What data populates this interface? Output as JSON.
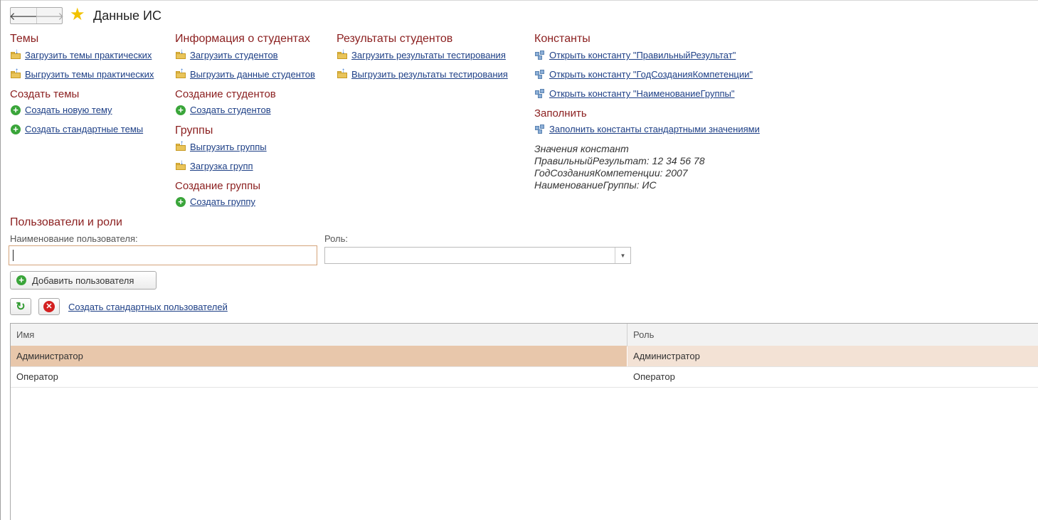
{
  "header": {
    "title": "Данные ИС",
    "back": "🡐",
    "forward": "🡒"
  },
  "themes": {
    "heading": "Темы",
    "load": "Загрузить темы практических",
    "unload": "Выгрузить темы практических",
    "create_heading": "Создать темы",
    "create_new": "Создать новую тему",
    "create_std": "Создать стандартные темы"
  },
  "students": {
    "heading": "Информация о студентах",
    "load": "Загрузить студентов",
    "unload": "Выгрузить данные студентов",
    "create_heading": "Создание студентов",
    "create": "Создать студентов"
  },
  "groups": {
    "heading": "Группы",
    "unload": "Выгрузить группы",
    "load": "Загрузка групп",
    "create_heading": "Создание группы",
    "create": "Создать группу"
  },
  "results": {
    "heading": "Результаты студентов",
    "load": "Загрузить результаты тестирования",
    "unload": "Выгрузить результаты тестирования"
  },
  "constants": {
    "heading": "Константы",
    "open1": "Открыть константу \"ПравильныйРезультат\"",
    "open2": "Открыть константу \"ГодСозданияКомпетенции\"",
    "open3": "Открыть константу \"НаименованиеГруппы\"",
    "fill_heading": "Заполнить",
    "fill": "Заполнить константы стандартными значениями",
    "values_title": "Значения констант",
    "value1": "ПравильныйРезультат: 12 34 56 78",
    "value2": "ГодСозданияКомпетенции: 2007",
    "value3": "НаименованиеГруппы: ИС"
  },
  "users": {
    "heading": "Пользователи и роли",
    "name_label": "Наименование пользователя:",
    "name_value": "",
    "role_label": "Роль:",
    "role_value": "",
    "add_button": "Добавить пользователя",
    "create_std": "Создать стандартных пользователей",
    "table": {
      "columns": [
        "Имя",
        "Роль"
      ],
      "rows": [
        {
          "name": "Администратор",
          "role": "Администратор",
          "selected": true
        },
        {
          "name": "Оператор",
          "role": "Оператор",
          "selected": false
        }
      ]
    }
  },
  "colors": {
    "section": "#8b1f1f",
    "link": "#1d3f86",
    "selected_row": "#e8c7ab"
  }
}
